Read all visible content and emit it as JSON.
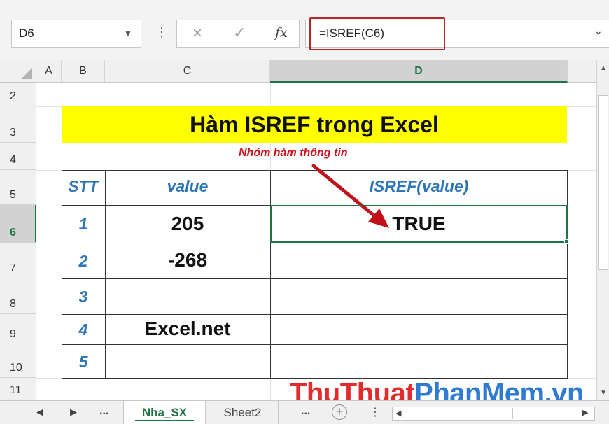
{
  "formula_bar": {
    "name_box": "D6",
    "cancel_icon": "×",
    "enter_icon": "✓",
    "fx_label": "fx",
    "formula": "=ISREF(C6)"
  },
  "columns": [
    "A",
    "B",
    "C",
    "D"
  ],
  "rows": [
    "2",
    "3",
    "4",
    "5",
    "6",
    "7",
    "8",
    "9",
    "10",
    "11"
  ],
  "sheet": {
    "title": "Hàm ISREF trong Excel",
    "subtitle": "Nhóm hàm thông tin",
    "headers": {
      "stt": "STT",
      "value": "value",
      "result": "ISREF(value)"
    },
    "table": [
      {
        "stt": "1",
        "value": "205",
        "result": "TRUE"
      },
      {
        "stt": "2",
        "value": "-268",
        "result": ""
      },
      {
        "stt": "3",
        "value": "",
        "result": ""
      },
      {
        "stt": "4",
        "value": "Excel.net",
        "result": ""
      },
      {
        "stt": "5",
        "value": "",
        "result": ""
      }
    ]
  },
  "watermark": {
    "part1": "ThuThuat",
    "part2": "PhanMem",
    "part3": ".vn"
  },
  "tabs": {
    "active": "Nha_SX",
    "other": "Sheet2",
    "more": "...",
    "add": "+"
  },
  "colors": {
    "selection_green": "#217346",
    "title_fill": "#ffff00",
    "header_blue": "#2e75b6",
    "subtitle_red": "#d0101a",
    "formula_highlight": "#b5262d"
  }
}
